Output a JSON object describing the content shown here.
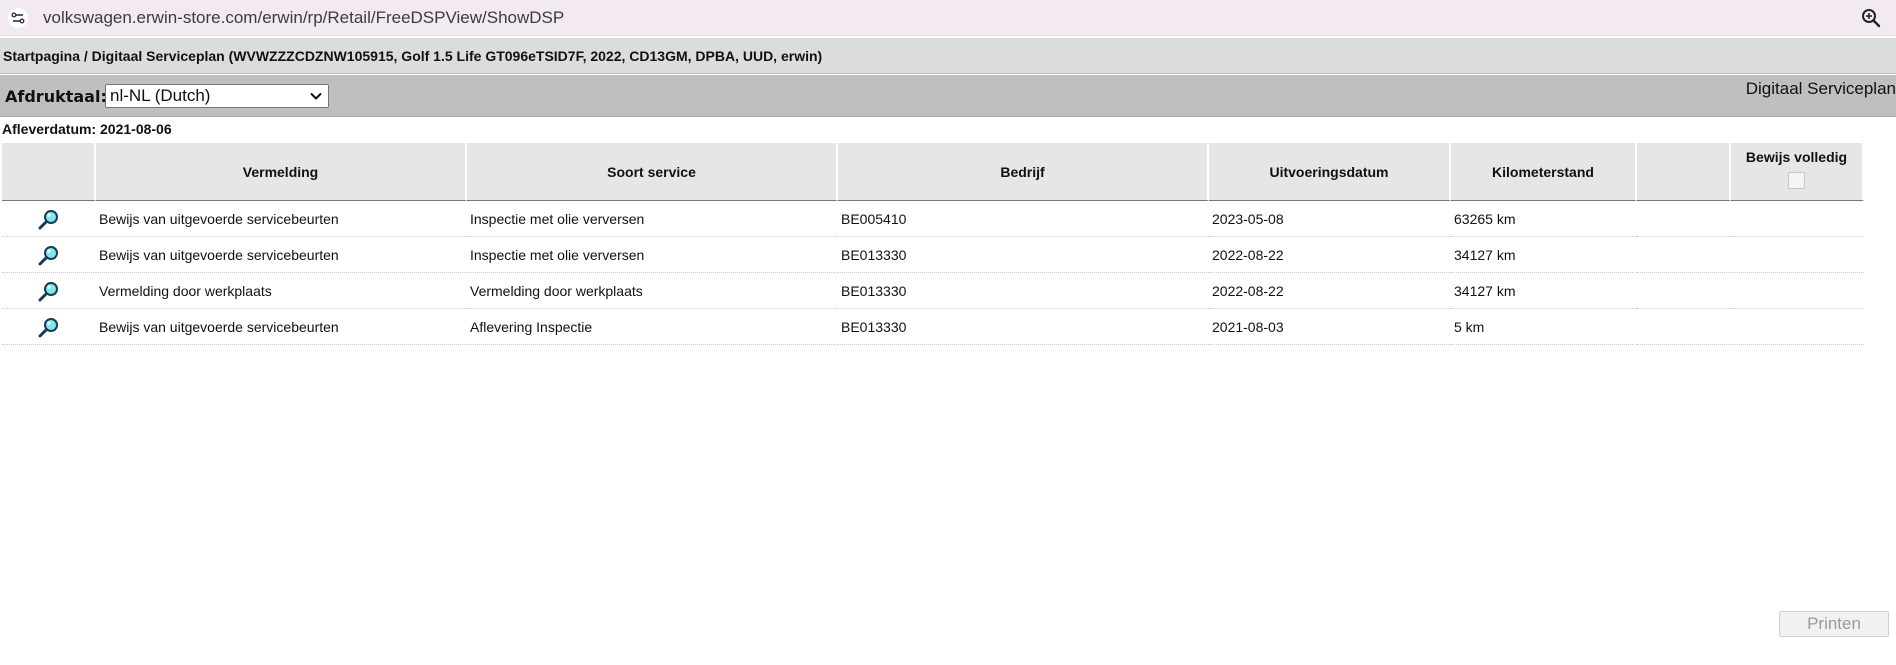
{
  "browser": {
    "url": "volkswagen.erwin-store.com/erwin/rp/Retail/FreeDSPView/ShowDSP"
  },
  "breadcrumb": {
    "text": "Startpagina / Digitaal Serviceplan (WVWZZZCDZNW105915, Golf 1.5 Life GT096eTSID7F, 2022, CD13GM, DPBA, UUD, erwin)"
  },
  "toolbar": {
    "language_label": "Afdruktaal:",
    "language_value": "nl-NL (Dutch)",
    "title": "Digitaal Serviceplan"
  },
  "delivery": {
    "text": "Afleverdatum: 2021-08-06"
  },
  "table": {
    "headers": [
      "",
      "Vermelding",
      "Soort service",
      "Bedrijf",
      "Uitvoeringsdatum",
      "Kilometerstand",
      "",
      "Bewijs volledig"
    ],
    "rows": [
      {
        "vermelding": "Bewijs van uitgevoerde servicebeurten",
        "soort": "Inspectie met olie verversen",
        "bedrijf": "BE005410",
        "datum": "2023-05-08",
        "km": "63265 km"
      },
      {
        "vermelding": "Bewijs van uitgevoerde servicebeurten",
        "soort": "Inspectie met olie verversen",
        "bedrijf": "BE013330",
        "datum": "2022-08-22",
        "km": "34127 km"
      },
      {
        "vermelding": "Vermelding door werkplaats",
        "soort": "Vermelding door werkplaats",
        "bedrijf": "BE013330",
        "datum": "2022-08-22",
        "km": "34127 km"
      },
      {
        "vermelding": "Bewijs van uitgevoerde servicebeurten",
        "soort": "Aflevering Inspectie",
        "bedrijf": "BE013330",
        "datum": "2021-08-03",
        "km": "5 km"
      }
    ]
  },
  "actions": {
    "print_label": "Printen"
  },
  "icons": {
    "site_info": "tune-icon",
    "zoom": "zoom-icon",
    "row_details": "magnifier-icon"
  }
}
